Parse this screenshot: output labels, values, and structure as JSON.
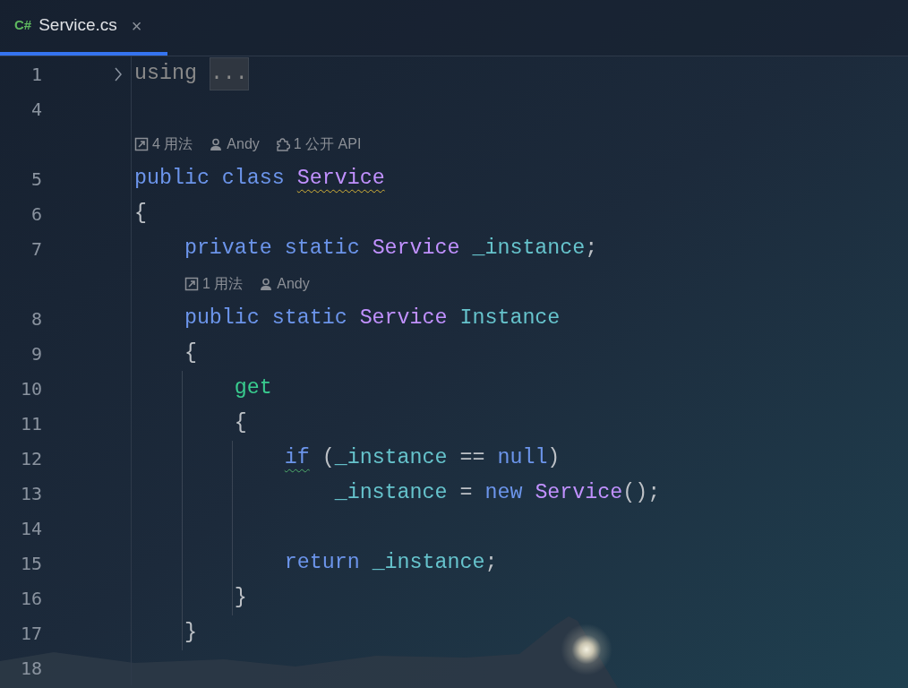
{
  "tab": {
    "language_badge": "C#",
    "title": "Service.cs",
    "close": "×",
    "selected": true
  },
  "lines": [
    {
      "number": "1",
      "folded": true,
      "tokens": [
        {
          "text": "using ",
          "kind": "dim"
        },
        {
          "text": "...",
          "kind": "fold"
        }
      ]
    },
    {
      "number": "4"
    },
    {
      "number": "5",
      "hints": [
        {
          "kind": "usages",
          "text": "4 用法"
        },
        {
          "kind": "author",
          "text": "Andy"
        },
        {
          "kind": "api",
          "text": "1 公开 API"
        }
      ],
      "tokens": [
        {
          "text": "public class ",
          "kind": "keyword"
        },
        {
          "text": "Service",
          "kind": "type",
          "warning": true
        }
      ]
    },
    {
      "number": "6",
      "tokens": [
        {
          "text": "{",
          "kind": "plain"
        }
      ]
    },
    {
      "number": "7",
      "tokens": [
        {
          "text": "    private static ",
          "kind": "keyword"
        },
        {
          "text": "Service ",
          "kind": "type"
        },
        {
          "text": "_instance",
          "kind": "field"
        },
        {
          "text": ";",
          "kind": "plain"
        }
      ]
    },
    {
      "number": "8",
      "hints": [
        {
          "kind": "usages",
          "text": "1 用法"
        },
        {
          "kind": "author",
          "text": "Andy"
        }
      ],
      "tokens": [
        {
          "text": "    public static ",
          "kind": "keyword"
        },
        {
          "text": "Service ",
          "kind": "type"
        },
        {
          "text": "Instance",
          "kind": "field"
        }
      ]
    },
    {
      "number": "9",
      "tokens": [
        {
          "text": "    {",
          "kind": "plain"
        }
      ]
    },
    {
      "number": "10",
      "tokens": [
        {
          "text": "        get",
          "kind": "accessor"
        }
      ]
    },
    {
      "number": "11",
      "tokens": [
        {
          "text": "        {",
          "kind": "plain"
        }
      ]
    },
    {
      "number": "12",
      "tokens": [
        {
          "text": "            if",
          "kind": "keyword",
          "suggestion": true
        },
        {
          "text": " (",
          "kind": "plain"
        },
        {
          "text": "_instance",
          "kind": "field"
        },
        {
          "text": " == ",
          "kind": "plain"
        },
        {
          "text": "null",
          "kind": "keyword"
        },
        {
          "text": ")",
          "kind": "plain"
        }
      ]
    },
    {
      "number": "13",
      "tokens": [
        {
          "text": "                _instance",
          "kind": "field"
        },
        {
          "text": " = ",
          "kind": "plain"
        },
        {
          "text": "new ",
          "kind": "keyword"
        },
        {
          "text": "Service",
          "kind": "type"
        },
        {
          "text": "();",
          "kind": "plain"
        }
      ]
    },
    {
      "number": "14"
    },
    {
      "number": "15",
      "tokens": [
        {
          "text": "            return ",
          "kind": "keyword"
        },
        {
          "text": "_instance",
          "kind": "field"
        },
        {
          "text": ";",
          "kind": "plain"
        }
      ]
    },
    {
      "number": "16",
      "tokens": [
        {
          "text": "        }",
          "kind": "plain"
        }
      ]
    },
    {
      "number": "17",
      "tokens": [
        {
          "text": "    }",
          "kind": "plain"
        }
      ]
    },
    {
      "number": "18"
    }
  ]
}
